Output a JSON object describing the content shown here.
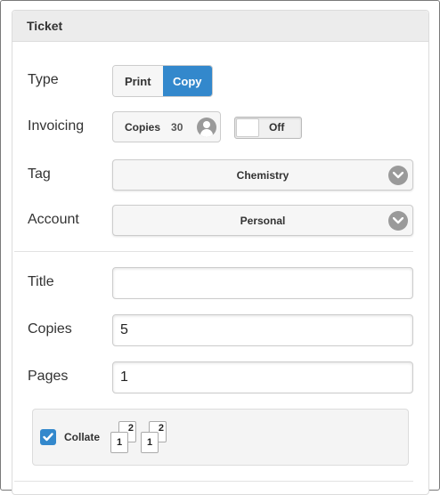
{
  "panel": {
    "title": "Ticket"
  },
  "type": {
    "label": "Type",
    "options": [
      "Print",
      "Copy"
    ],
    "selected": "Copy"
  },
  "invoicing": {
    "label": "Invoicing",
    "copies_label": "Copies",
    "copies_count": "30",
    "toggle_label": "Off"
  },
  "tag": {
    "label": "Tag",
    "value": "Chemistry"
  },
  "account": {
    "label": "Account",
    "value": "Personal"
  },
  "title": {
    "label": "Title",
    "value": ""
  },
  "copies": {
    "label": "Copies",
    "value": "5"
  },
  "pages": {
    "label": "Pages",
    "value": "1"
  },
  "collate": {
    "label": "Collate",
    "checked": true,
    "pages": [
      "1",
      "2",
      "1",
      "2"
    ]
  },
  "colors": {
    "accent": "#3388cc",
    "header_bg": "#ececec",
    "icon_gray": "#9a9a9a"
  }
}
